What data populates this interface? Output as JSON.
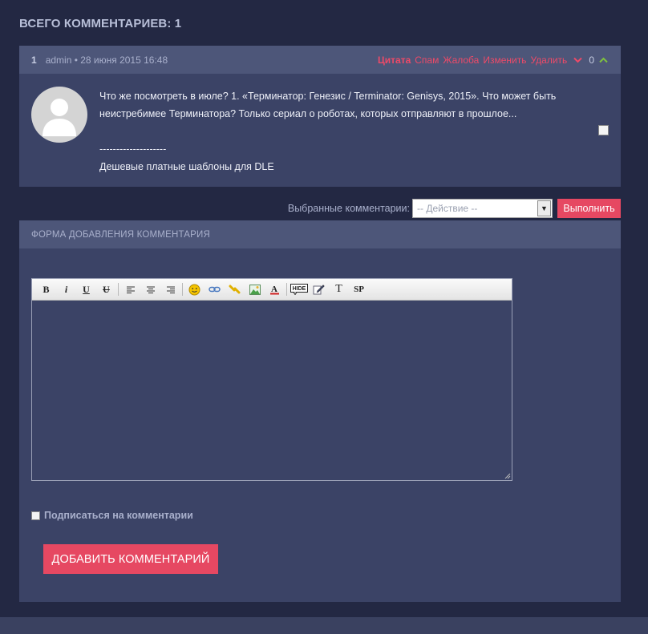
{
  "comments": {
    "header": "ВСЕГО КОММЕНТАРИЕВ: 1",
    "item": {
      "number": "1",
      "meta": "admin • 28 июня 2015 16:48",
      "actions": [
        "Цитата",
        "Спам",
        "Жалоба",
        "Изменить",
        "Удалить"
      ],
      "rating": "0",
      "text": "Что же посмотреть в июле? 1. «Терминатор: Генезис / Terminator: Genisys, 2015». Что может быть неистребимее Терминатора? Только сериал о роботах, которых отправляют в прошлое...",
      "sig_divider": "--------------------",
      "signature": "Дешевые платные шаблоны для DLE"
    }
  },
  "mass_action": {
    "label": "Выбранные комментарии:",
    "select_value": "-- Действие --",
    "button": "Выполнить"
  },
  "form": {
    "title": "ФОРМА ДОБАВЛЕНИЯ КОММЕНТАРИЯ",
    "toolbar": {
      "bold": "B",
      "italic": "i",
      "underline": "U",
      "strike": "U",
      "text": "T",
      "spoiler": "SP",
      "hide": "HIDE"
    },
    "subscribe_label": "Подписаться на комментарии",
    "submit": "ДОБАВИТЬ КОММЕНТАРИЙ"
  },
  "colors": {
    "accent": "#e64862",
    "vote_up": "#7ec13f",
    "panel": "#3b4366",
    "panel_head": "#4d5679",
    "background": "#232843"
  }
}
